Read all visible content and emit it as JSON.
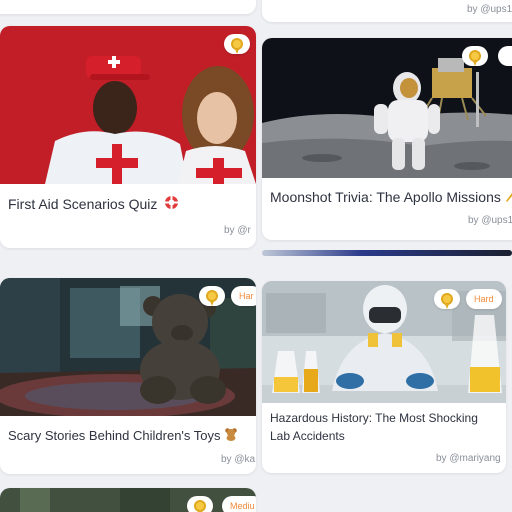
{
  "cards": {
    "top_left": {
      "title": "",
      "by": ""
    },
    "top_right": {
      "by": "by @ups1"
    },
    "first_aid": {
      "title": "First Aid Scenarios Quiz",
      "by": "by @r",
      "emoji": "lifebuoy-icon"
    },
    "moonshot": {
      "title": "Moonshot Trivia: The Apollo Missions",
      "by": "by @ups1",
      "emoji": "rocket-icon"
    },
    "scary": {
      "title": "Scary Stories Behind Children's Toys",
      "by": "by @ka",
      "difficulty": "Har",
      "emoji": "teddy-bear-icon"
    },
    "hazardous": {
      "title": "Hazardous History: The Most Shocking Lab Accidents",
      "by": "by @mariyang",
      "difficulty": "Hard"
    },
    "bottom_left": {
      "difficulty": "Mediu"
    }
  },
  "colors": {
    "badge_gold": "#f6c945",
    "difficulty_text": "#f08a3a",
    "title_text": "#2f3340",
    "byline_text": "#8a8f99"
  }
}
